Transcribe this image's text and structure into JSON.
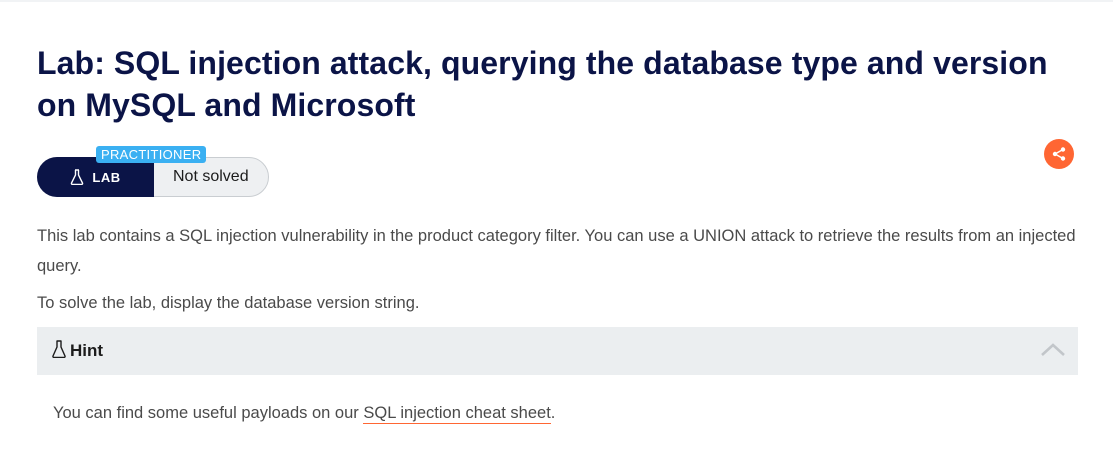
{
  "page": {
    "title": "Lab: SQL injection attack, querying the database type and version on MySQL and Microsoft"
  },
  "badge": {
    "level": "PRACTITIONER",
    "type": "LAB",
    "status": "Not solved"
  },
  "description": {
    "paragraph1": "This lab contains a SQL injection vulnerability in the product category filter. You can use a UNION attack to retrieve the results from an injected query.",
    "paragraph2": "To solve the lab, display the database version string."
  },
  "hint": {
    "label": "Hint",
    "text_before": "You can find some useful payloads on our ",
    "link_text": "SQL injection cheat sheet",
    "text_after": "."
  },
  "colors": {
    "navy": "#0b1447",
    "accent_orange": "#ff6633",
    "practitioner_blue": "#3ab0f2",
    "hint_background": "#ebeef0"
  },
  "icons": {
    "lab": "flask-icon",
    "share": "share-icon",
    "hint": "flask-icon",
    "collapse": "chevron-up-icon"
  }
}
